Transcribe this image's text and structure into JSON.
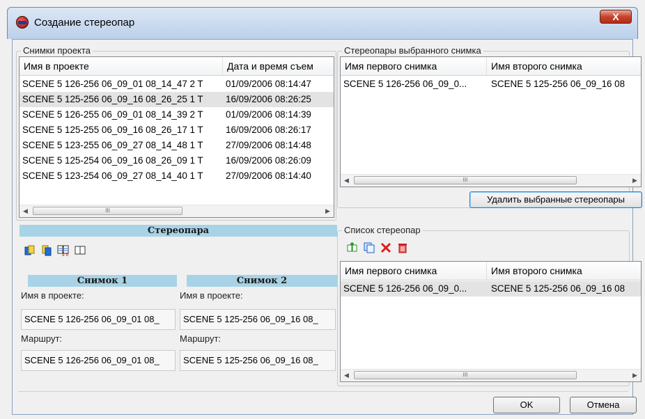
{
  "window": {
    "title": "Создание стереопар",
    "close_glyph": "X"
  },
  "project_images": {
    "group_label": "Снимки проекта",
    "columns": [
      "Имя в проекте",
      "Дата и время съем"
    ],
    "rows": [
      {
        "name": "SCENE 5 126-256 06_09_01 08_14_47 2 T",
        "date": "01/09/2006 08:14:47"
      },
      {
        "name": "SCENE 5 125-256 06_09_16 08_26_25 1 T",
        "date": "16/09/2006 08:26:25"
      },
      {
        "name": "SCENE 5 126-255 06_09_01 08_14_39 2 T",
        "date": "01/09/2006 08:14:39"
      },
      {
        "name": "SCENE 5 125-255 06_09_16 08_26_17 1 T",
        "date": "16/09/2006 08:26:17"
      },
      {
        "name": "SCENE 5 123-255 06_09_27 08_14_48 1 T",
        "date": "27/09/2006 08:14:48"
      },
      {
        "name": "SCENE 5 125-254 06_09_16 08_26_09 1 T",
        "date": "16/09/2006 08:26:09"
      },
      {
        "name": "SCENE 5 123-254 06_09_27 08_14_40 1 T",
        "date": "27/09/2006 08:14:40"
      }
    ],
    "selected_row": 1,
    "scroll_thumb_glyph": "III"
  },
  "stereopair": {
    "title": "Стереопара",
    "toolbar_icons": [
      "copy-left-icon",
      "copy-right-icon",
      "swap-images-icon",
      "side-by-side-icon"
    ],
    "image1": {
      "title": "Снимок 1",
      "name_label": "Имя в проекте:",
      "name_value": "SCENE 5 126-256 06_09_01 08_",
      "route_label": "Маршрут:",
      "route_value": "SCENE 5 126-256 06_09_01 08_"
    },
    "image2": {
      "title": "Снимок 2",
      "name_label": "Имя в проекте:",
      "name_value": "SCENE 5 125-256 06_09_16 08_",
      "route_label": "Маршрут:",
      "route_value": "SCENE 5 125-256 06_09_16 08_"
    }
  },
  "selected_stereopairs": {
    "group_label": "Стереопары выбранного снимка",
    "columns": [
      "Имя первого снимка",
      "Имя второго снимка"
    ],
    "rows": [
      {
        "first": "SCENE 5 126-256 06_09_0...",
        "second": "SCENE 5 125-256 06_09_16 08"
      }
    ],
    "delete_button": "Удалить выбранные стереопары",
    "scroll_thumb_glyph": "III"
  },
  "stereopair_list": {
    "group_label": "Список стереопар",
    "toolbar_icons": [
      "add-stereopair-icon",
      "auto-create-icon",
      "delete-icon",
      "delete-all-icon"
    ],
    "columns": [
      "Имя первого снимка",
      "Имя второго снимка"
    ],
    "rows": [
      {
        "first": "SCENE 5 126-256 06_09_0...",
        "second": "SCENE 5 125-256 06_09_16 08"
      }
    ],
    "scroll_thumb_glyph": "III"
  },
  "footer": {
    "ok": "OK",
    "cancel": "Отмена"
  }
}
